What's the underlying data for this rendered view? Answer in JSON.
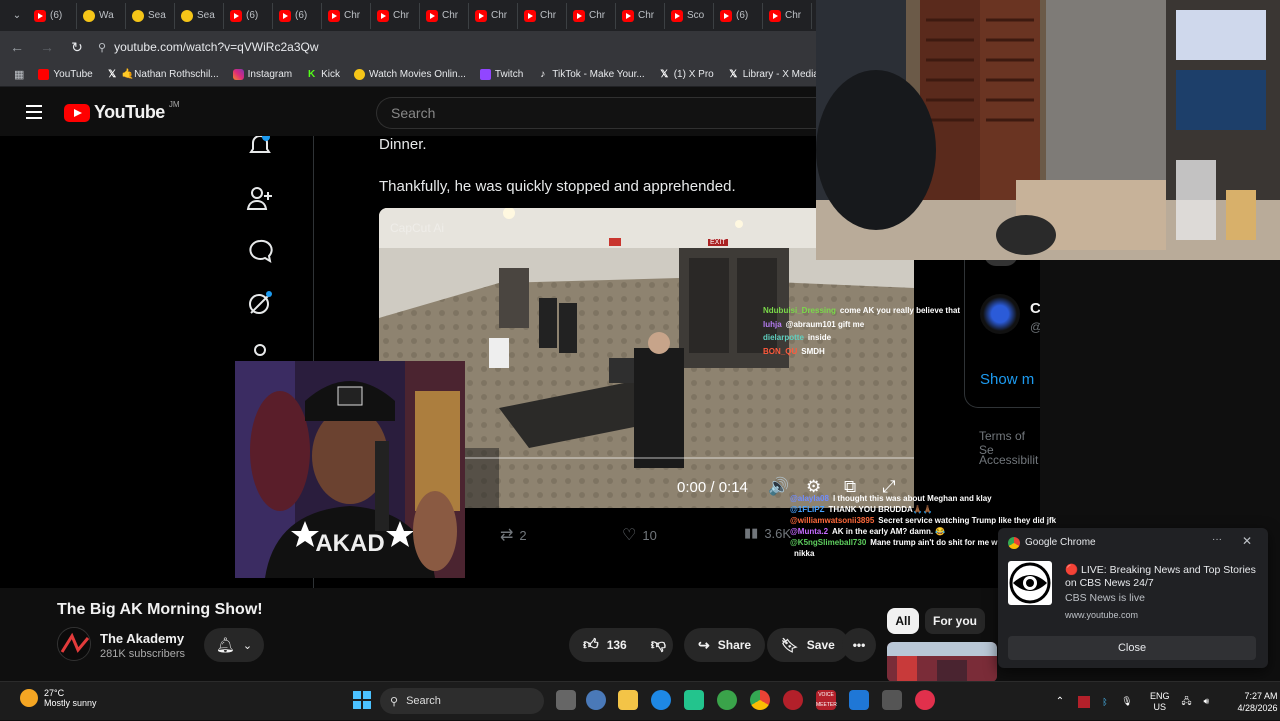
{
  "browser": {
    "tabs": [
      {
        "label": "(6)",
        "icon": "youtube-icon"
      },
      {
        "label": "Wa",
        "icon": "smile-icon"
      },
      {
        "label": "Sea",
        "icon": "smile-icon"
      },
      {
        "label": "Sea",
        "icon": "smile-icon"
      },
      {
        "label": "(6)",
        "icon": "youtube-icon"
      },
      {
        "label": "(6)",
        "icon": "youtube-icon"
      },
      {
        "label": "Chr",
        "icon": "youtube-icon"
      },
      {
        "label": "Chr",
        "icon": "youtube-icon"
      },
      {
        "label": "Chr",
        "icon": "youtube-icon"
      },
      {
        "label": "Chr",
        "icon": "youtube-icon"
      },
      {
        "label": "Chr",
        "icon": "youtube-icon"
      },
      {
        "label": "Chr",
        "icon": "youtube-icon"
      },
      {
        "label": "Chr",
        "icon": "youtube-icon"
      },
      {
        "label": "Sco",
        "icon": "youtube-icon"
      },
      {
        "label": "(6)",
        "icon": "youtube-icon"
      },
      {
        "label": "Chr",
        "icon": "youtube-icon"
      }
    ],
    "url": "youtube.com/watch?v=qVWiRc2a3Qw",
    "bookmarks": [
      {
        "label": "YouTube",
        "icon": "youtube-icon"
      },
      {
        "label": "🤙Nathan Rothschil...",
        "icon": "x-icon"
      },
      {
        "label": "Instagram",
        "icon": "instagram-icon"
      },
      {
        "label": "Kick",
        "icon": "kick-icon"
      },
      {
        "label": "Watch Movies Onlin...",
        "icon": "smile-icon"
      },
      {
        "label": "Twitch",
        "icon": "twitch-icon"
      },
      {
        "label": "TikTok - Make Your...",
        "icon": "tiktok-icon"
      },
      {
        "label": "(1) X Pro",
        "icon": "x-icon"
      },
      {
        "label": "Library - X Media St...",
        "icon": "x-icon"
      }
    ]
  },
  "youtube": {
    "logo_text": "YouTube",
    "country_code": "JM",
    "search_placeholder": "Search"
  },
  "tweet": {
    "text1": "Dinner.",
    "text2": "Thankfully, he was quickly stopped and apprehended.",
    "watermark": "CapCut Ai",
    "exit_sign": "EXIT",
    "video_time": "0:00 / 0:14",
    "retweets": "2",
    "likes": "10",
    "views": "3.6K",
    "right_name": "C",
    "right_handle": "@",
    "show_more": "Show m",
    "terms": "Terms of Se",
    "accessibility": "Accessibilit"
  },
  "chat_top": [
    {
      "user": "Ndubuisi_Dressing",
      "msg": "come AK you really believe that",
      "color": "#7bd94a"
    },
    {
      "user": "luhja",
      "msg": "@abraum101 gift me",
      "color": "#b57cf2"
    },
    {
      "user": "dielarpotte",
      "msg": "inside",
      "color": "#5fd0c0"
    },
    {
      "user": "BON_QU",
      "msg": "SMDH",
      "color": "#ff5a3c"
    }
  ],
  "chat_bottom": [
    {
      "user": "@alayla08",
      "msg": "I thought this was about Meghan and klay",
      "color": "#6f8bff"
    },
    {
      "user": "@1FLIPZ",
      "msg": "THANK YOU BRUDDA🙏🏾🙏🏾",
      "color": "#4aa3ff"
    },
    {
      "user": "@williamwatsonii3895",
      "msg": "Secret service watching Trump like they did jfk",
      "color": "#ff6a3c"
    },
    {
      "user": "@Munta.2",
      "msg": "AK in the early AM? damn. 😂",
      "color": "#c66bff"
    },
    {
      "user": "@K5ngSlimeball730",
      "msg": "Mane trump ain't do shit for me who ca",
      "color": "#5fd05f"
    },
    {
      "user": "",
      "msg": "nikka",
      "color": "#ffffff"
    }
  ],
  "video_info": {
    "title": "The Big AK Morning Show!",
    "channel": "The Akademy",
    "subscribers": "281K subscribers",
    "likes": "136",
    "share": "Share",
    "save": "Save",
    "chip_all": "All",
    "chip_for_you": "For you"
  },
  "notification": {
    "app": "Google Chrome",
    "title": "🔴 LIVE: Breaking News and Top Stories on CBS News 24/7",
    "subtitle": "CBS News is live",
    "url": "www.youtube.com",
    "close": "Close"
  },
  "taskbar": {
    "temperature": "27°C",
    "weather": "Mostly sunny",
    "search": "Search",
    "lang1": "ENG",
    "lang2": "US",
    "time": "7:27 AM",
    "date": "4/28/2026",
    "voicemeeter": "VOICE MEETER"
  },
  "colors": {
    "youtube_red": "#ff0000",
    "chrome_dark": "#202124",
    "notif_bg": "#202124"
  }
}
